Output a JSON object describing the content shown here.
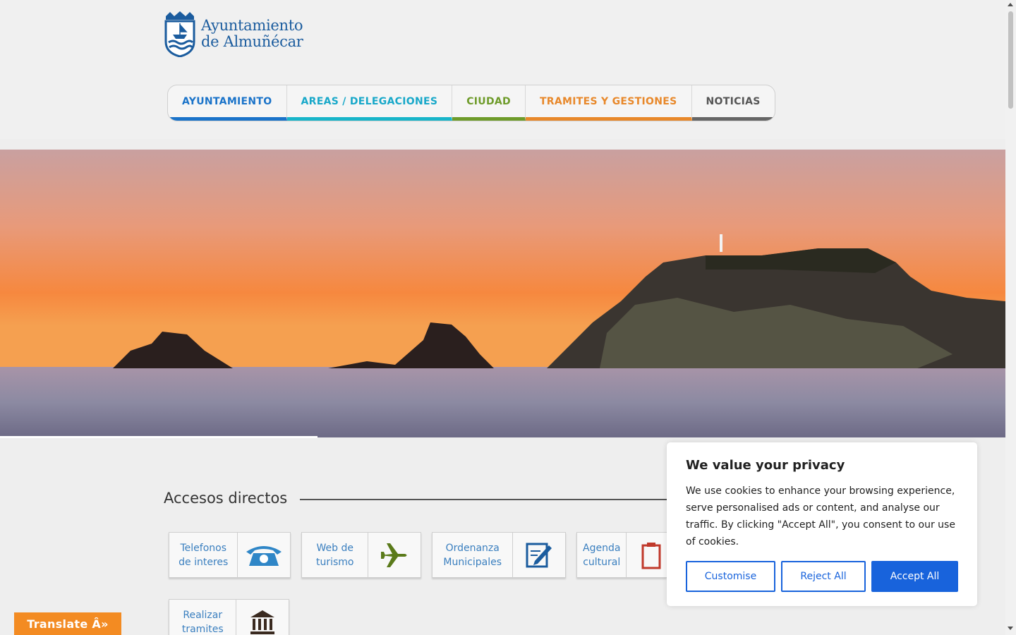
{
  "header": {
    "logo_line1": "Ayuntamiento",
    "logo_line2": "de Almuñécar"
  },
  "nav": [
    {
      "label": "AYUNTAMIENTO",
      "color": "#1a73c9",
      "underline": "#1a73c9"
    },
    {
      "label": "AREAS / DELEGACIONES",
      "color": "#18a8c9",
      "underline": "#18b5c9"
    },
    {
      "label": "CIUDAD",
      "color": "#6e9b2a",
      "underline": "#6e9b2a"
    },
    {
      "label": "TRAMITES Y GESTIONES",
      "color": "#e8882a",
      "underline": "#e8882a"
    },
    {
      "label": "NOTICIAS",
      "color": "#555555",
      "underline": "#666666"
    }
  ],
  "accesos": {
    "title": "Accesos directos",
    "tiles": [
      {
        "label": "Telefonos de interes",
        "icon": "telephone-icon"
      },
      {
        "label": "Web de turismo",
        "icon": "airplane-icon"
      },
      {
        "label": "Ordenanza Municipales",
        "icon": "document-edit-icon"
      },
      {
        "label": "Agenda cultural",
        "icon": "clipboard-icon"
      },
      {
        "label": "Realizar tramites",
        "icon": "building-icon"
      }
    ]
  },
  "cookie": {
    "title": "We value your privacy",
    "text": "We use cookies to enhance your browsing experience, serve personalised ads or content, and analyse our traffic. By clicking \"Accept All\", you consent to our use of cookies.",
    "customise": "Customise",
    "reject": "Reject All",
    "accept": "Accept All"
  },
  "translate": {
    "label": "Translate Â»"
  },
  "colors": {
    "brand_blue": "#1b5c9e",
    "link_blue": "#3a7fbf",
    "cookie_accent": "#1863dc",
    "translate_orange": "#f38b22"
  }
}
